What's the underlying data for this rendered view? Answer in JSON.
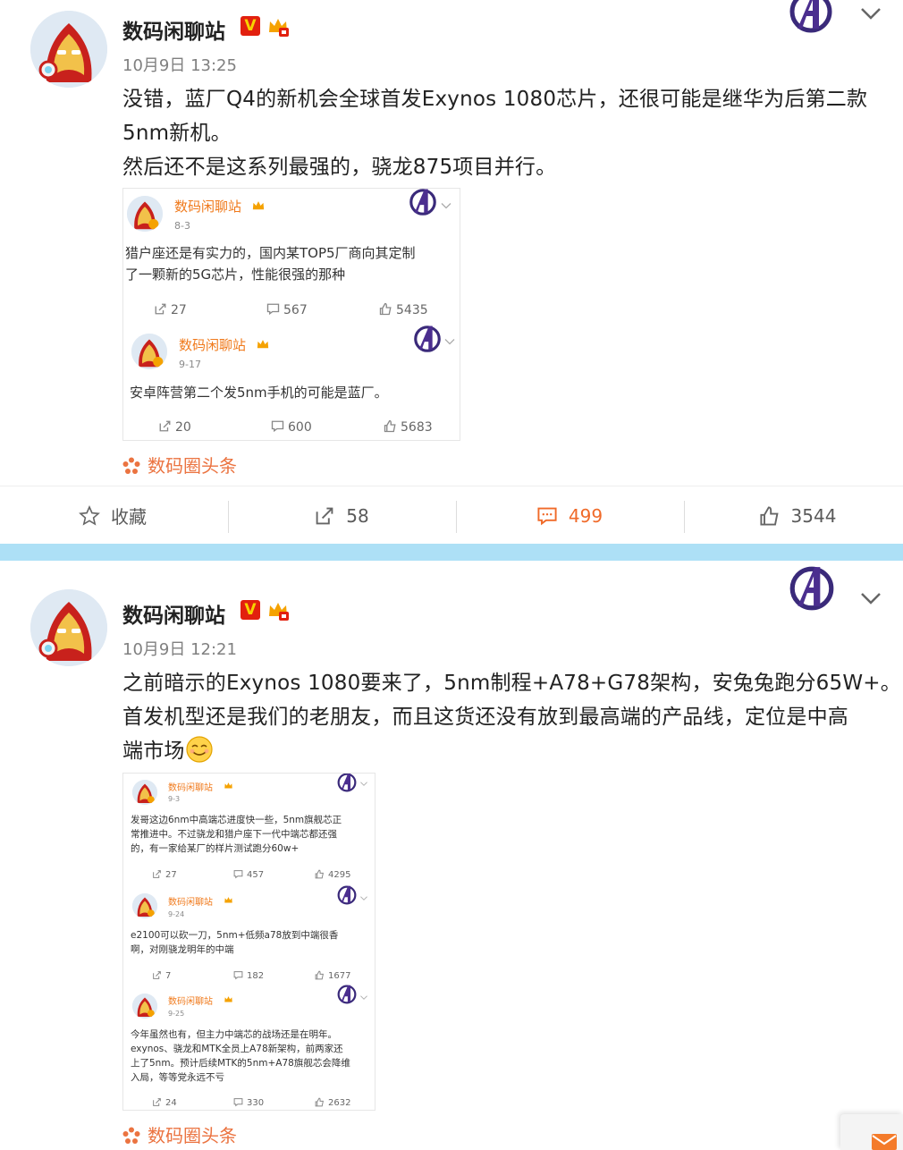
{
  "colors": {
    "accent_orange": "#f06a29",
    "brand_red": "#e2200e",
    "separator_blue": "#ade0f6",
    "name_orange": "#f07a1c"
  },
  "post1": {
    "username": "数码闲聊站",
    "v_label": "V",
    "timestamp": "10月9日 13:25",
    "text_lines": [
      "没错，蓝厂Q4的新机会全球首发Exynos 1080芯片，还很可能是继华为后第二款",
      "5nm新机。",
      "然后还不是这系列最强的，骁龙875项目并行。"
    ],
    "embed": {
      "posts": [
        {
          "username": "数码闲聊站",
          "date": "8-3",
          "lines": [
            "猎户座还是有实力的，国内某TOP5厂商向其定制",
            "了一颗新的5G芯片，性能很强的那种"
          ],
          "reposts": "27",
          "comments": "567",
          "likes": "5435"
        },
        {
          "username": "数码闲聊站",
          "date": "9-17",
          "lines": [
            "安卓阵营第二个发5nm手机的可能是蓝厂。"
          ],
          "reposts": "20",
          "comments": "600",
          "likes": "5683"
        }
      ]
    },
    "source": "数码圈头条",
    "actions": {
      "favorite": "收藏",
      "reposts": "58",
      "comments": "499",
      "likes": "3544"
    }
  },
  "post2": {
    "username": "数码闲聊站",
    "v_label": "V",
    "timestamp": "10月9日 12:21",
    "text_lines": [
      "之前暗示的Exynos 1080要来了，5nm制程+A78+G78架构，安兔兔跑分65W+。",
      "首发机型还是我们的老朋友，而且这货还没有放到最高端的产品线，定位是中高",
      "端市场"
    ],
    "embed": {
      "posts": [
        {
          "username": "数码闲聊站",
          "date": "9-3",
          "lines": [
            "发哥这边6nm中高端芯进度快一些，5nm旗舰芯正",
            "常推进中。不过骁龙和猎户座下一代中端芯都还强",
            "的，有一家给某厂的样片测试跑分60w+"
          ],
          "reposts": "27",
          "comments": "457",
          "likes": "4295"
        },
        {
          "username": "数码闲聊站",
          "date": "9-24",
          "lines": [
            "e2100可以砍一刀，5nm+低频a78放到中端很香",
            "啊，对刚骁龙明年的中端"
          ],
          "reposts": "7",
          "comments": "182",
          "likes": "1677"
        },
        {
          "username": "数码闲聊站",
          "date": "9-25",
          "lines": [
            "今年虽然也有，但主力中端芯的战场还是在明年。",
            "exynos、骁龙和MTK全员上A78新架构，前两家还",
            "上了5nm。预计后续MTK的5nm+A78旗舰芯会降维",
            "入局，等等党永远不亏"
          ],
          "reposts": "24",
          "comments": "330",
          "likes": "2632"
        }
      ]
    },
    "source": "数码圈头条"
  }
}
